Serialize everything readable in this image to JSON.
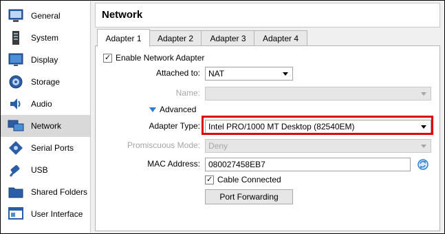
{
  "sidebar": {
    "items": [
      {
        "label": "General",
        "icon": "general-icon"
      },
      {
        "label": "System",
        "icon": "system-icon"
      },
      {
        "label": "Display",
        "icon": "display-icon"
      },
      {
        "label": "Storage",
        "icon": "storage-icon"
      },
      {
        "label": "Audio",
        "icon": "audio-icon"
      },
      {
        "label": "Network",
        "icon": "network-icon",
        "selected": true
      },
      {
        "label": "Serial Ports",
        "icon": "serial-ports-icon"
      },
      {
        "label": "USB",
        "icon": "usb-icon"
      },
      {
        "label": "Shared Folders",
        "icon": "shared-folders-icon"
      },
      {
        "label": "User Interface",
        "icon": "user-interface-icon"
      }
    ]
  },
  "header": {
    "title": "Network"
  },
  "tabs": [
    {
      "label": "Adapter 1",
      "active": true
    },
    {
      "label": "Adapter 2"
    },
    {
      "label": "Adapter 3"
    },
    {
      "label": "Adapter 4"
    }
  ],
  "adapter": {
    "enable_label": "Enable Network Adapter",
    "enable_checked": true,
    "attached_to_label": "Attached to:",
    "attached_to_value": "NAT",
    "name_label": "Name:",
    "name_value": "",
    "advanced_label": "Advanced",
    "adapter_type_label": "Adapter Type:",
    "adapter_type_value": "Intel PRO/1000 MT Desktop (82540EM)",
    "promiscuous_label": "Promiscuous Mode:",
    "promiscuous_value": "Deny",
    "mac_label": "MAC Address:",
    "mac_value": "080027458EB7",
    "cable_label": "Cable Connected",
    "cable_checked": true,
    "port_forwarding_label": "Port Forwarding"
  },
  "colors": {
    "highlight": "#e00000",
    "selected_bg": "#d9d9d9"
  }
}
